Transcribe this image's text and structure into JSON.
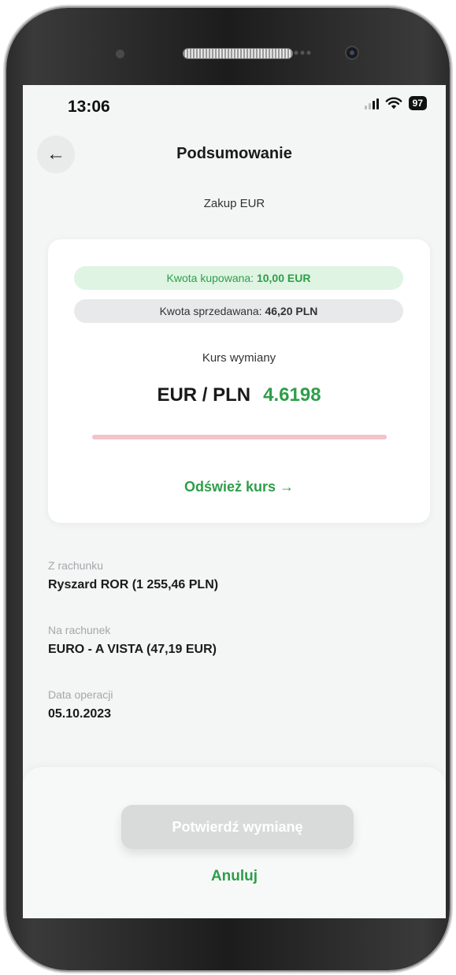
{
  "status_bar": {
    "time": "13:06",
    "battery": "97"
  },
  "header": {
    "title": "Podsumowanie",
    "back_icon": "arrow-left-icon"
  },
  "subtitle": "Zakup EUR",
  "summary_card": {
    "buy_label": "Kwota kupowana:",
    "buy_amount": "10,00 EUR",
    "sell_label": "Kwota sprzedawana:",
    "sell_amount": "46,20 PLN",
    "rate_label": "Kurs wymiany",
    "rate_pair": "EUR / PLN",
    "rate_value": "4.6198",
    "rate_validity_fraction": 1.0,
    "refresh_label": "Odśwież kurs →"
  },
  "details": {
    "from_account_label": "Z rachunku",
    "from_account_value": "Ryszard ROR (1 255,46 PLN)",
    "to_account_label": "Na rachunek",
    "to_account_value": "EURO - A VISTA (47,19 EUR)",
    "date_label": "Data operacji",
    "date_value": "05.10.2023"
  },
  "actions": {
    "confirm_label": "Potwierdź wymianę",
    "cancel_label": "Anuluj"
  },
  "colors": {
    "accent_green": "#2e9e4a",
    "buy_pill_bg": "#dff4e3",
    "timer_bar": "#f3c3c9",
    "disabled_button": "#d9dbdb"
  }
}
